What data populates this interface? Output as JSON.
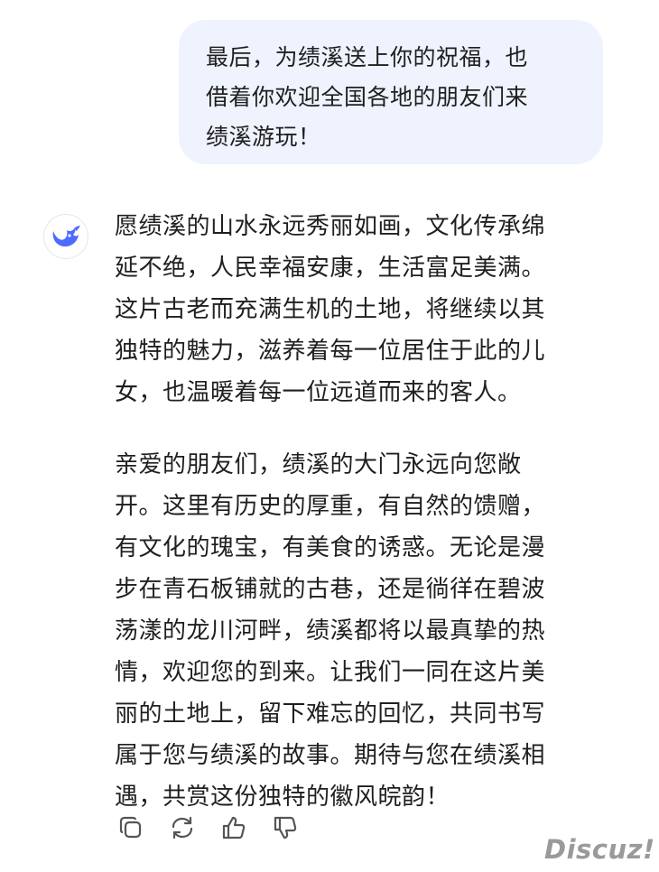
{
  "user_message": {
    "lines": [
      "最后，为绩溪送上你的祝福，也",
      "借着你欢迎全国各地的朋友们来",
      "绩溪游玩！"
    ]
  },
  "assistant": {
    "avatar_icon": "whale-logo-icon",
    "brand_color": "#4d6bfe",
    "paragraph_1": [
      "愿绩溪的山水永远秀丽如画，文化传承绵",
      "延不绝，人民幸福安康，生活富足美满。",
      "这片古老而充满生机的土地，将继续以其",
      "独特的魅力，滋养着每一位居住于此的儿",
      "女，也温暖着每一位远道而来的客人。"
    ],
    "paragraph_2": [
      "亲爱的朋友们，绩溪的大门永远向您敞",
      "开。这里有历史的厚重，有自然的馈赠，",
      "有文化的瑰宝，有美食的诱惑。无论是漫",
      "步在青石板铺就的古巷，还是徜徉在碧波",
      "荡漾的龙川河畔，绩溪都将以最真挚的热",
      "情，欢迎您的到来。让我们一同在这片美",
      "丽的土地上，留下难忘的回忆，共同书写",
      "属于您与绩溪的故事。期待与您在绩溪相",
      "遇，共赏这份独特的徽风皖韵！"
    ]
  },
  "actions": {
    "icons": [
      "copy-icon",
      "regenerate-icon",
      "thumbs-up-icon",
      "thumbs-down-icon"
    ]
  },
  "watermark": {
    "text": "Discuz!"
  }
}
